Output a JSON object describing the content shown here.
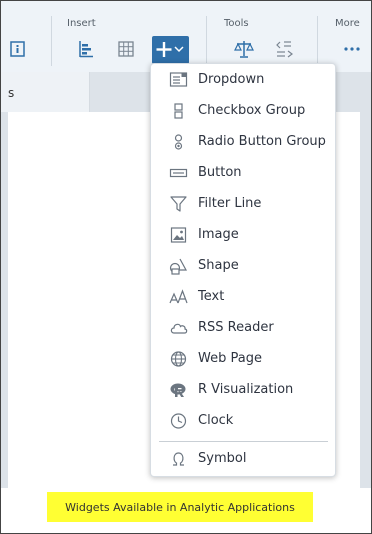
{
  "toolbar": {
    "groups": [
      {
        "label": "Insert"
      },
      {
        "label": "Tools"
      },
      {
        "label": "More"
      }
    ],
    "icons": [
      "info-icon",
      "bar-chart-icon",
      "table-grid-icon",
      "add-widget-icon",
      "scale-icon",
      "formula-icon",
      "more-icon"
    ]
  },
  "tab": {
    "label": "s"
  },
  "menu": {
    "items": [
      {
        "label": "Dropdown",
        "icon": "dropdown-icon"
      },
      {
        "label": "Checkbox Group",
        "icon": "checkbox-group-icon"
      },
      {
        "label": "Radio Button Group",
        "icon": "radio-button-group-icon"
      },
      {
        "label": "Button",
        "icon": "button-icon"
      },
      {
        "label": "Filter Line",
        "icon": "filter-icon"
      },
      {
        "label": "Image",
        "icon": "image-icon"
      },
      {
        "label": "Shape",
        "icon": "shape-icon"
      },
      {
        "label": "Text",
        "icon": "text-icon"
      },
      {
        "label": "RSS Reader",
        "icon": "cloud-icon"
      },
      {
        "label": "Web Page",
        "icon": "globe-icon"
      },
      {
        "label": "R Visualization",
        "icon": "r-icon"
      },
      {
        "label": "Clock",
        "icon": "clock-icon"
      },
      {
        "label": "Symbol",
        "icon": "omega-icon"
      }
    ]
  },
  "caption": {
    "text": "Widgets Available in Analytic Applications"
  },
  "colors": {
    "accent": "#2f6fa9",
    "highlight": "#ffff33",
    "toolbar": "#eef3f8"
  }
}
